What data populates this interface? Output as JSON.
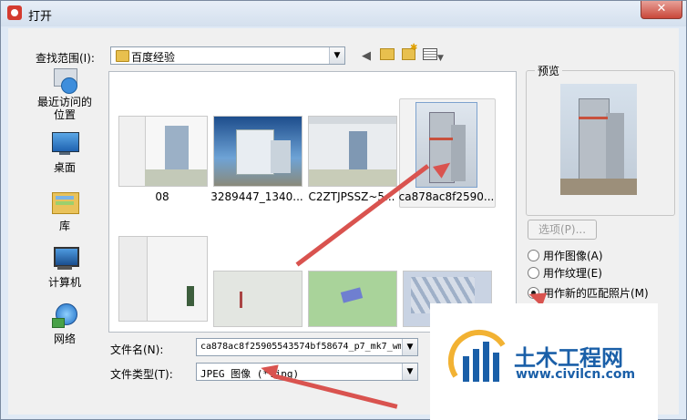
{
  "window": {
    "title": "打开",
    "close_glyph": "✕"
  },
  "lookin": {
    "label": "查找范围(I):",
    "value": "百度经验"
  },
  "toolbar": {
    "back_icon": "back-arrow-icon",
    "up_icon": "up-folder-icon",
    "new_icon": "new-folder-icon",
    "views_icon": "views-menu-icon"
  },
  "places": [
    {
      "label": "最近访问的位置",
      "icon": "recent-places-icon"
    },
    {
      "label": "桌面",
      "icon": "desktop-icon"
    },
    {
      "label": "库",
      "icon": "libraries-icon"
    },
    {
      "label": "计算机",
      "icon": "computer-icon"
    },
    {
      "label": "网络",
      "icon": "network-icon"
    }
  ],
  "files": [
    {
      "label": "08"
    },
    {
      "label": "3289447_1340..."
    },
    {
      "label": "C2ZTJPSSZ~5..."
    },
    {
      "label": "ca878ac8f2590..."
    }
  ],
  "filename": {
    "label": "文件名(N):",
    "value": "ca878ac8f25905543574bf58674_p7_mk7_wm"
  },
  "filetype": {
    "label": "文件类型(T):",
    "value": "JPEG 图像 (*.jpg)"
  },
  "preview": {
    "label": "预览"
  },
  "options_button": {
    "label": "选项(P)..."
  },
  "radios": [
    {
      "label": "用作图像(A)",
      "checked": false
    },
    {
      "label": "用作纹理(E)",
      "checked": false
    },
    {
      "label": "用作新的匹配照片(M)",
      "checked": true
    }
  ],
  "watermark": {
    "brand": "土木工程网",
    "url": "www.civilcn.com"
  },
  "colors": {
    "accent_arrow": "#d9534f",
    "logo_blue": "#1a5fa8"
  }
}
